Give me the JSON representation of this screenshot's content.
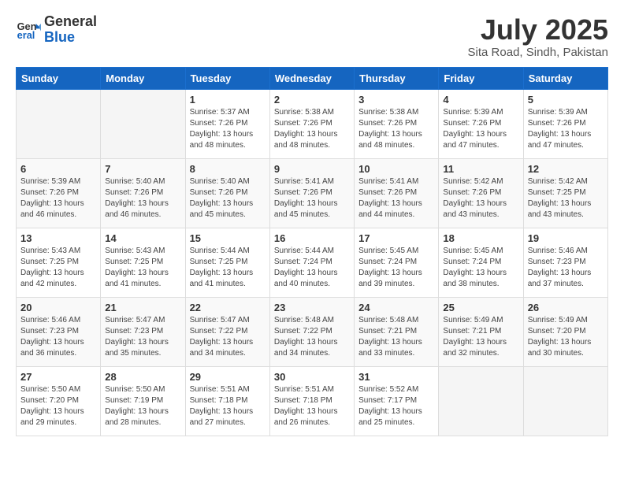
{
  "logo": {
    "line1": "General",
    "line2": "Blue"
  },
  "header": {
    "month": "July 2025",
    "location": "Sita Road, Sindh, Pakistan"
  },
  "weekdays": [
    "Sunday",
    "Monday",
    "Tuesday",
    "Wednesday",
    "Thursday",
    "Friday",
    "Saturday"
  ],
  "weeks": [
    [
      {
        "day": "",
        "info": ""
      },
      {
        "day": "",
        "info": ""
      },
      {
        "day": "1",
        "info": "Sunrise: 5:37 AM\nSunset: 7:26 PM\nDaylight: 13 hours and 48 minutes."
      },
      {
        "day": "2",
        "info": "Sunrise: 5:38 AM\nSunset: 7:26 PM\nDaylight: 13 hours and 48 minutes."
      },
      {
        "day": "3",
        "info": "Sunrise: 5:38 AM\nSunset: 7:26 PM\nDaylight: 13 hours and 48 minutes."
      },
      {
        "day": "4",
        "info": "Sunrise: 5:39 AM\nSunset: 7:26 PM\nDaylight: 13 hours and 47 minutes."
      },
      {
        "day": "5",
        "info": "Sunrise: 5:39 AM\nSunset: 7:26 PM\nDaylight: 13 hours and 47 minutes."
      }
    ],
    [
      {
        "day": "6",
        "info": "Sunrise: 5:39 AM\nSunset: 7:26 PM\nDaylight: 13 hours and 46 minutes."
      },
      {
        "day": "7",
        "info": "Sunrise: 5:40 AM\nSunset: 7:26 PM\nDaylight: 13 hours and 46 minutes."
      },
      {
        "day": "8",
        "info": "Sunrise: 5:40 AM\nSunset: 7:26 PM\nDaylight: 13 hours and 45 minutes."
      },
      {
        "day": "9",
        "info": "Sunrise: 5:41 AM\nSunset: 7:26 PM\nDaylight: 13 hours and 45 minutes."
      },
      {
        "day": "10",
        "info": "Sunrise: 5:41 AM\nSunset: 7:26 PM\nDaylight: 13 hours and 44 minutes."
      },
      {
        "day": "11",
        "info": "Sunrise: 5:42 AM\nSunset: 7:26 PM\nDaylight: 13 hours and 43 minutes."
      },
      {
        "day": "12",
        "info": "Sunrise: 5:42 AM\nSunset: 7:25 PM\nDaylight: 13 hours and 43 minutes."
      }
    ],
    [
      {
        "day": "13",
        "info": "Sunrise: 5:43 AM\nSunset: 7:25 PM\nDaylight: 13 hours and 42 minutes."
      },
      {
        "day": "14",
        "info": "Sunrise: 5:43 AM\nSunset: 7:25 PM\nDaylight: 13 hours and 41 minutes."
      },
      {
        "day": "15",
        "info": "Sunrise: 5:44 AM\nSunset: 7:25 PM\nDaylight: 13 hours and 41 minutes."
      },
      {
        "day": "16",
        "info": "Sunrise: 5:44 AM\nSunset: 7:24 PM\nDaylight: 13 hours and 40 minutes."
      },
      {
        "day": "17",
        "info": "Sunrise: 5:45 AM\nSunset: 7:24 PM\nDaylight: 13 hours and 39 minutes."
      },
      {
        "day": "18",
        "info": "Sunrise: 5:45 AM\nSunset: 7:24 PM\nDaylight: 13 hours and 38 minutes."
      },
      {
        "day": "19",
        "info": "Sunrise: 5:46 AM\nSunset: 7:23 PM\nDaylight: 13 hours and 37 minutes."
      }
    ],
    [
      {
        "day": "20",
        "info": "Sunrise: 5:46 AM\nSunset: 7:23 PM\nDaylight: 13 hours and 36 minutes."
      },
      {
        "day": "21",
        "info": "Sunrise: 5:47 AM\nSunset: 7:23 PM\nDaylight: 13 hours and 35 minutes."
      },
      {
        "day": "22",
        "info": "Sunrise: 5:47 AM\nSunset: 7:22 PM\nDaylight: 13 hours and 34 minutes."
      },
      {
        "day": "23",
        "info": "Sunrise: 5:48 AM\nSunset: 7:22 PM\nDaylight: 13 hours and 34 minutes."
      },
      {
        "day": "24",
        "info": "Sunrise: 5:48 AM\nSunset: 7:21 PM\nDaylight: 13 hours and 33 minutes."
      },
      {
        "day": "25",
        "info": "Sunrise: 5:49 AM\nSunset: 7:21 PM\nDaylight: 13 hours and 32 minutes."
      },
      {
        "day": "26",
        "info": "Sunrise: 5:49 AM\nSunset: 7:20 PM\nDaylight: 13 hours and 30 minutes."
      }
    ],
    [
      {
        "day": "27",
        "info": "Sunrise: 5:50 AM\nSunset: 7:20 PM\nDaylight: 13 hours and 29 minutes."
      },
      {
        "day": "28",
        "info": "Sunrise: 5:50 AM\nSunset: 7:19 PM\nDaylight: 13 hours and 28 minutes."
      },
      {
        "day": "29",
        "info": "Sunrise: 5:51 AM\nSunset: 7:18 PM\nDaylight: 13 hours and 27 minutes."
      },
      {
        "day": "30",
        "info": "Sunrise: 5:51 AM\nSunset: 7:18 PM\nDaylight: 13 hours and 26 minutes."
      },
      {
        "day": "31",
        "info": "Sunrise: 5:52 AM\nSunset: 7:17 PM\nDaylight: 13 hours and 25 minutes."
      },
      {
        "day": "",
        "info": ""
      },
      {
        "day": "",
        "info": ""
      }
    ]
  ]
}
